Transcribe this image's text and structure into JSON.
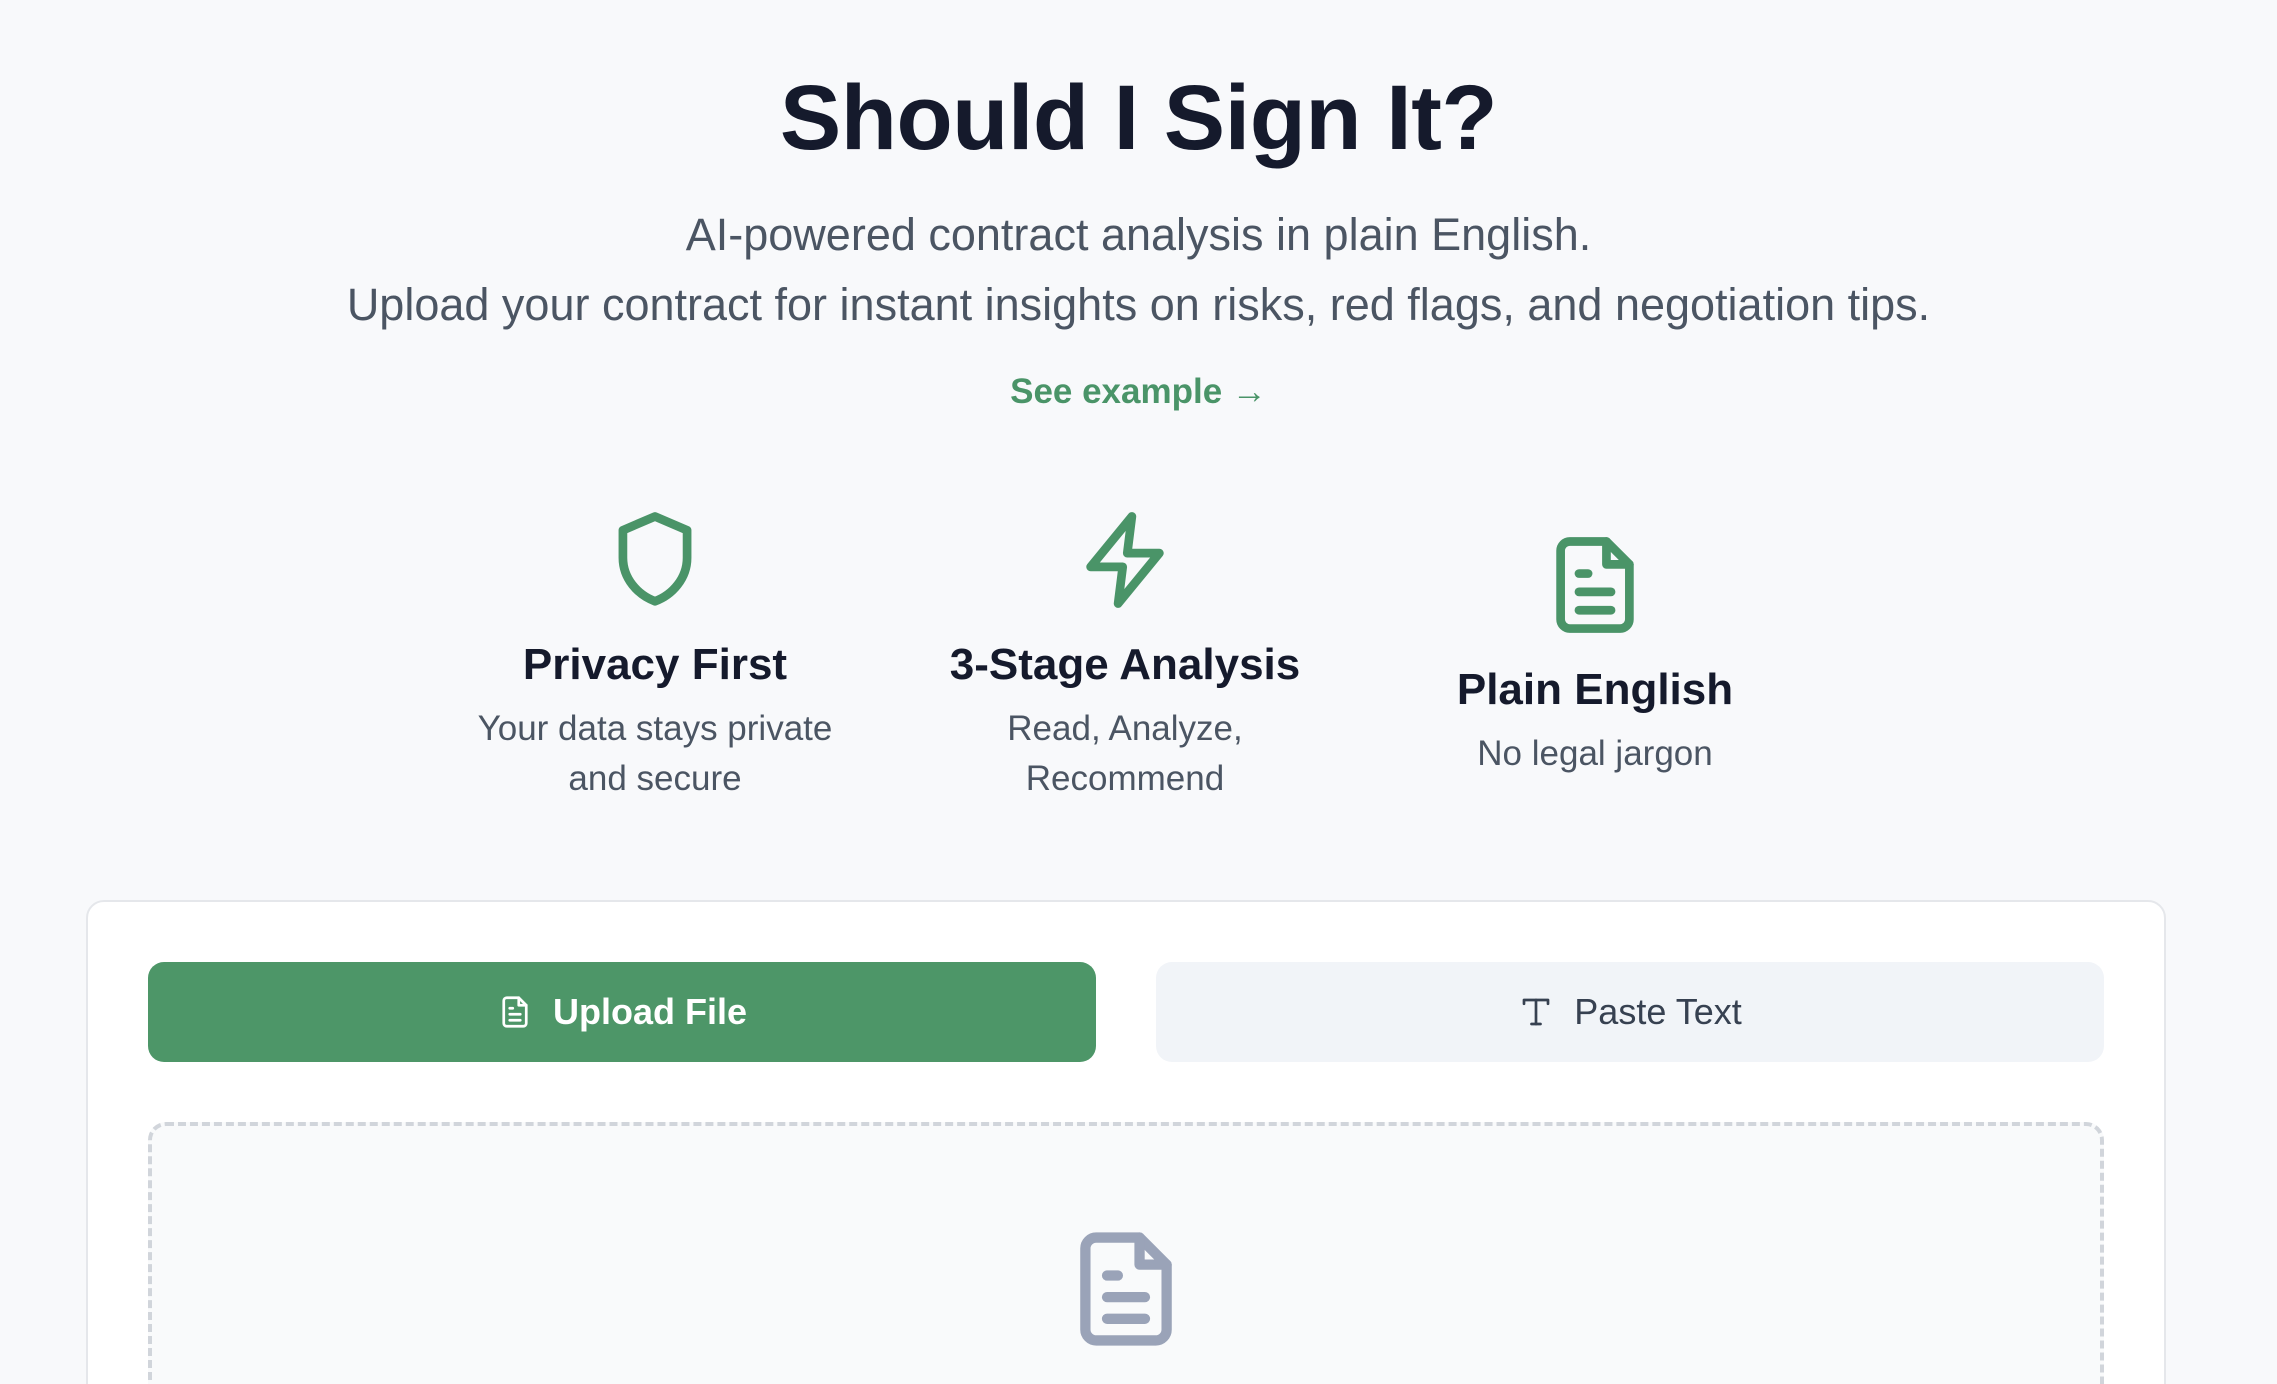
{
  "hero": {
    "title": "Should I Sign It?",
    "subtitle_line1": "AI-powered contract analysis in plain English.",
    "subtitle_line2": "Upload your contract for instant insights on risks, red flags, and negotiation tips.",
    "example_link": "See example →"
  },
  "features": [
    {
      "icon": "shield-icon",
      "title": "Privacy First",
      "description": "Your data stays private and secure"
    },
    {
      "icon": "lightning-icon",
      "title": "3-Stage Analysis",
      "description": "Read, Analyze, Recommend"
    },
    {
      "icon": "document-icon",
      "title": "Plain English",
      "description": "No legal jargon"
    }
  ],
  "input_card": {
    "tabs": {
      "upload_label": "Upload File",
      "paste_label": "Paste Text"
    },
    "dropzone_icon": "document-icon"
  },
  "colors": {
    "accent": "#4d9668",
    "title": "#151a2c",
    "muted_text": "#4b5563",
    "background": "#f8f9fb"
  }
}
